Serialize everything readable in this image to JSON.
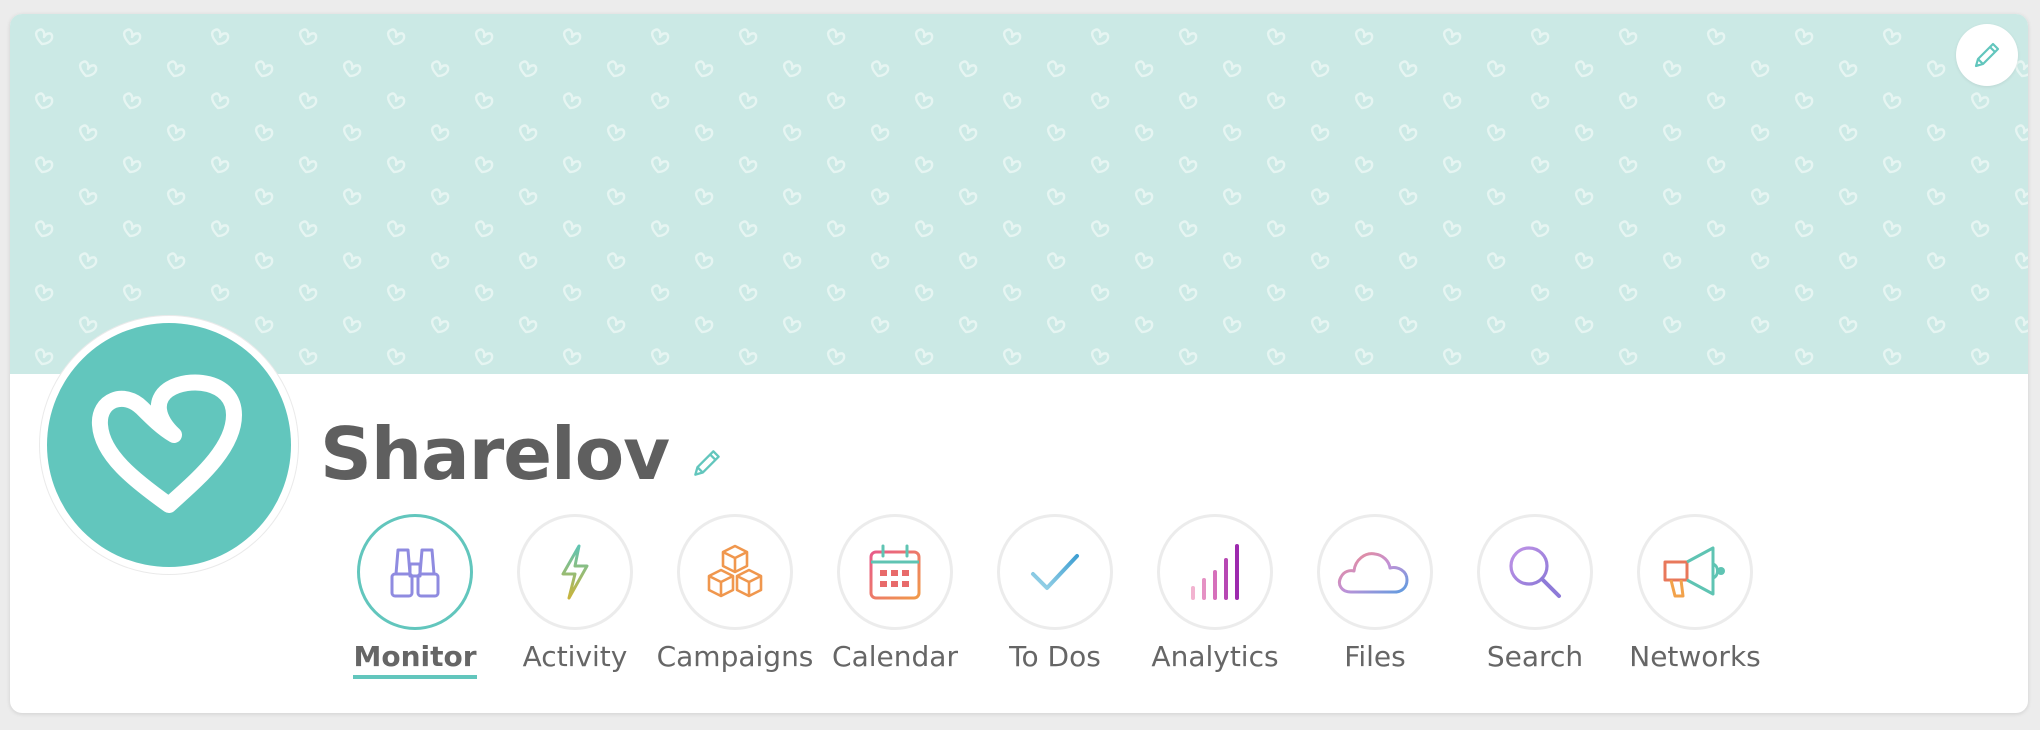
{
  "profile": {
    "name": "Sharelov",
    "brand_color": "#62c6bd",
    "banner_color": "#cbe9e5"
  },
  "icons": {
    "edit_banner": "pencil-icon",
    "edit_name": "pencil-icon",
    "avatar": "heart-logo-icon"
  },
  "nav": {
    "active": "Monitor",
    "items": [
      {
        "label": "Monitor",
        "icon": "binoculars-icon"
      },
      {
        "label": "Activity",
        "icon": "lightning-bolt-icon"
      },
      {
        "label": "Campaigns",
        "icon": "boxes-icon"
      },
      {
        "label": "Calendar",
        "icon": "calendar-icon"
      },
      {
        "label": "To Dos",
        "icon": "checkmark-icon"
      },
      {
        "label": "Analytics",
        "icon": "bar-chart-icon"
      },
      {
        "label": "Files",
        "icon": "cloud-icon"
      },
      {
        "label": "Search",
        "icon": "magnifier-icon"
      },
      {
        "label": "Networks",
        "icon": "megaphone-icon"
      }
    ]
  }
}
